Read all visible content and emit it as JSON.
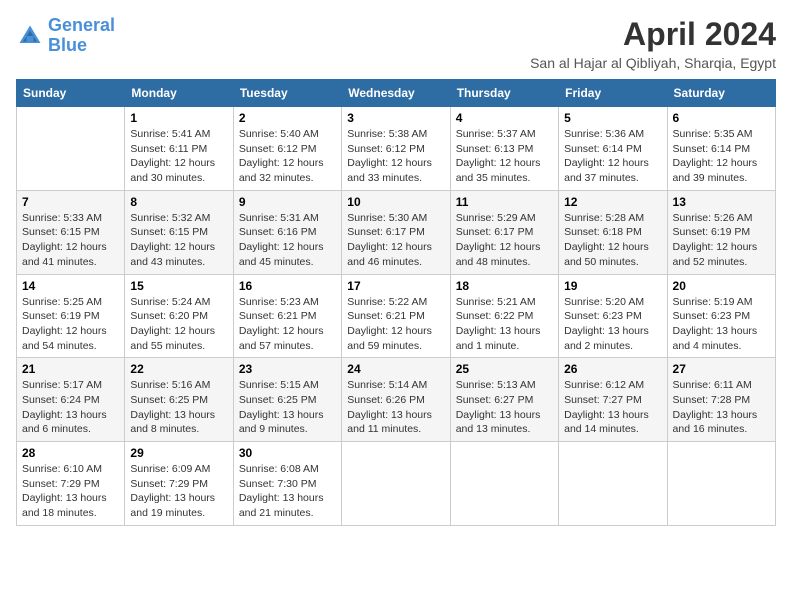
{
  "logo": {
    "line1": "General",
    "line2": "Blue"
  },
  "title": "April 2024",
  "location": "San al Hajar al Qibliyah, Sharqia, Egypt",
  "headers": [
    "Sunday",
    "Monday",
    "Tuesday",
    "Wednesday",
    "Thursday",
    "Friday",
    "Saturday"
  ],
  "weeks": [
    [
      {
        "day": null,
        "content": null
      },
      {
        "day": "1",
        "content": "Sunrise: 5:41 AM\nSunset: 6:11 PM\nDaylight: 12 hours\nand 30 minutes."
      },
      {
        "day": "2",
        "content": "Sunrise: 5:40 AM\nSunset: 6:12 PM\nDaylight: 12 hours\nand 32 minutes."
      },
      {
        "day": "3",
        "content": "Sunrise: 5:38 AM\nSunset: 6:12 PM\nDaylight: 12 hours\nand 33 minutes."
      },
      {
        "day": "4",
        "content": "Sunrise: 5:37 AM\nSunset: 6:13 PM\nDaylight: 12 hours\nand 35 minutes."
      },
      {
        "day": "5",
        "content": "Sunrise: 5:36 AM\nSunset: 6:14 PM\nDaylight: 12 hours\nand 37 minutes."
      },
      {
        "day": "6",
        "content": "Sunrise: 5:35 AM\nSunset: 6:14 PM\nDaylight: 12 hours\nand 39 minutes."
      }
    ],
    [
      {
        "day": "7",
        "content": "Sunrise: 5:33 AM\nSunset: 6:15 PM\nDaylight: 12 hours\nand 41 minutes."
      },
      {
        "day": "8",
        "content": "Sunrise: 5:32 AM\nSunset: 6:15 PM\nDaylight: 12 hours\nand 43 minutes."
      },
      {
        "day": "9",
        "content": "Sunrise: 5:31 AM\nSunset: 6:16 PM\nDaylight: 12 hours\nand 45 minutes."
      },
      {
        "day": "10",
        "content": "Sunrise: 5:30 AM\nSunset: 6:17 PM\nDaylight: 12 hours\nand 46 minutes."
      },
      {
        "day": "11",
        "content": "Sunrise: 5:29 AM\nSunset: 6:17 PM\nDaylight: 12 hours\nand 48 minutes."
      },
      {
        "day": "12",
        "content": "Sunrise: 5:28 AM\nSunset: 6:18 PM\nDaylight: 12 hours\nand 50 minutes."
      },
      {
        "day": "13",
        "content": "Sunrise: 5:26 AM\nSunset: 6:19 PM\nDaylight: 12 hours\nand 52 minutes."
      }
    ],
    [
      {
        "day": "14",
        "content": "Sunrise: 5:25 AM\nSunset: 6:19 PM\nDaylight: 12 hours\nand 54 minutes."
      },
      {
        "day": "15",
        "content": "Sunrise: 5:24 AM\nSunset: 6:20 PM\nDaylight: 12 hours\nand 55 minutes."
      },
      {
        "day": "16",
        "content": "Sunrise: 5:23 AM\nSunset: 6:21 PM\nDaylight: 12 hours\nand 57 minutes."
      },
      {
        "day": "17",
        "content": "Sunrise: 5:22 AM\nSunset: 6:21 PM\nDaylight: 12 hours\nand 59 minutes."
      },
      {
        "day": "18",
        "content": "Sunrise: 5:21 AM\nSunset: 6:22 PM\nDaylight: 13 hours\nand 1 minute."
      },
      {
        "day": "19",
        "content": "Sunrise: 5:20 AM\nSunset: 6:23 PM\nDaylight: 13 hours\nand 2 minutes."
      },
      {
        "day": "20",
        "content": "Sunrise: 5:19 AM\nSunset: 6:23 PM\nDaylight: 13 hours\nand 4 minutes."
      }
    ],
    [
      {
        "day": "21",
        "content": "Sunrise: 5:17 AM\nSunset: 6:24 PM\nDaylight: 13 hours\nand 6 minutes."
      },
      {
        "day": "22",
        "content": "Sunrise: 5:16 AM\nSunset: 6:25 PM\nDaylight: 13 hours\nand 8 minutes."
      },
      {
        "day": "23",
        "content": "Sunrise: 5:15 AM\nSunset: 6:25 PM\nDaylight: 13 hours\nand 9 minutes."
      },
      {
        "day": "24",
        "content": "Sunrise: 5:14 AM\nSunset: 6:26 PM\nDaylight: 13 hours\nand 11 minutes."
      },
      {
        "day": "25",
        "content": "Sunrise: 5:13 AM\nSunset: 6:27 PM\nDaylight: 13 hours\nand 13 minutes."
      },
      {
        "day": "26",
        "content": "Sunrise: 6:12 AM\nSunset: 7:27 PM\nDaylight: 13 hours\nand 14 minutes."
      },
      {
        "day": "27",
        "content": "Sunrise: 6:11 AM\nSunset: 7:28 PM\nDaylight: 13 hours\nand 16 minutes."
      }
    ],
    [
      {
        "day": "28",
        "content": "Sunrise: 6:10 AM\nSunset: 7:29 PM\nDaylight: 13 hours\nand 18 minutes."
      },
      {
        "day": "29",
        "content": "Sunrise: 6:09 AM\nSunset: 7:29 PM\nDaylight: 13 hours\nand 19 minutes."
      },
      {
        "day": "30",
        "content": "Sunrise: 6:08 AM\nSunset: 7:30 PM\nDaylight: 13 hours\nand 21 minutes."
      },
      {
        "day": null,
        "content": null
      },
      {
        "day": null,
        "content": null
      },
      {
        "day": null,
        "content": null
      },
      {
        "day": null,
        "content": null
      }
    ]
  ]
}
